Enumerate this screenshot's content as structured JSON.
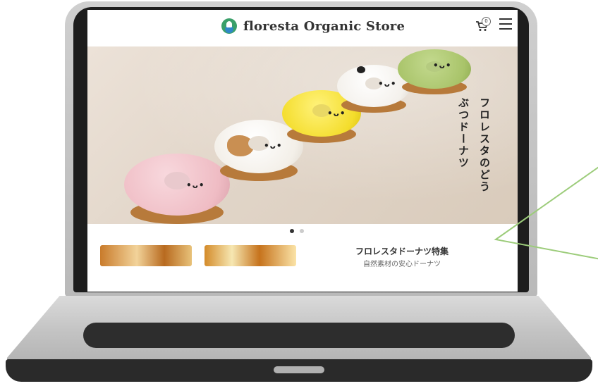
{
  "site": {
    "brand_name": "floresta Organic Store",
    "cart_count": "0"
  },
  "hero": {
    "copy": "フロレスタのどうぶつドーナツ",
    "faces": [
      "•ᴗ•",
      "•ᴗ•",
      "•ᴗ•",
      "•ᴗ•",
      "•ᴗ•"
    ]
  },
  "carousel": {
    "slides": 2,
    "active_slide": 1
  },
  "feature": {
    "title": "フロレスタドーナツ特集",
    "subtitle": "自然素材の安心ドーナツ"
  },
  "icons": {
    "logo": "leaf-drop-logo-icon",
    "cart": "cart-icon",
    "menu": "hamburger-menu-icon"
  },
  "colors": {
    "accent_green": "#9ccc7a",
    "logo_green": "#3aa06a",
    "logo_blue": "#2f87c8"
  }
}
